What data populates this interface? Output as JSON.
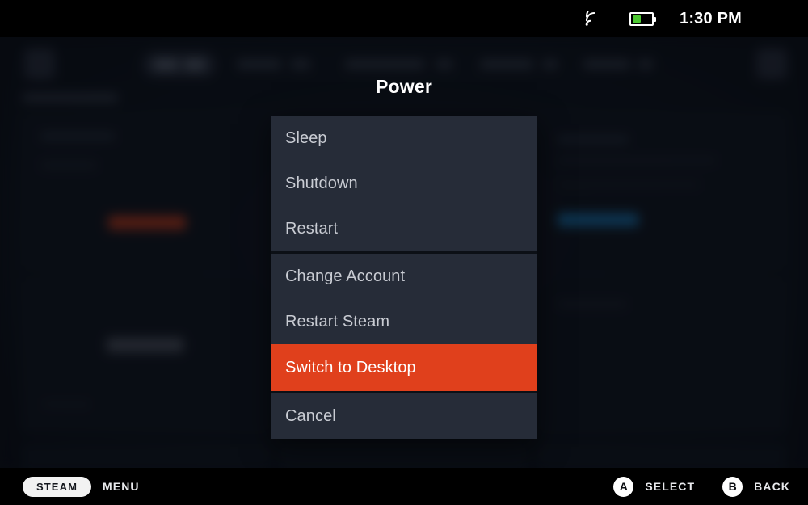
{
  "statusbar": {
    "wifi_icon": "wifi-icon",
    "battery_icon": "battery-icon",
    "battery_level_percent": 45,
    "clock": "1:30 PM"
  },
  "dialog": {
    "title": "Power",
    "groups": [
      {
        "items": [
          {
            "label": "Sleep",
            "selected": false
          },
          {
            "label": "Shutdown",
            "selected": false
          },
          {
            "label": "Restart",
            "selected": false
          }
        ]
      },
      {
        "items": [
          {
            "label": "Change Account",
            "selected": false
          },
          {
            "label": "Restart Steam",
            "selected": false
          },
          {
            "label": "Switch to Desktop",
            "selected": true
          }
        ]
      },
      {
        "items": [
          {
            "label": "Cancel",
            "selected": false
          }
        ]
      }
    ]
  },
  "bottombar": {
    "steam_button": "STEAM",
    "menu_label": "MENU",
    "actions": [
      {
        "glyph": "A",
        "label": "SELECT",
        "icon": "a-button-icon"
      },
      {
        "glyph": "B",
        "label": "BACK",
        "icon": "b-button-icon"
      }
    ]
  },
  "colors": {
    "highlight": "#e0401c",
    "menu_background": "#262c38",
    "battery_green": "#4dc832",
    "bar_black": "#000000"
  }
}
